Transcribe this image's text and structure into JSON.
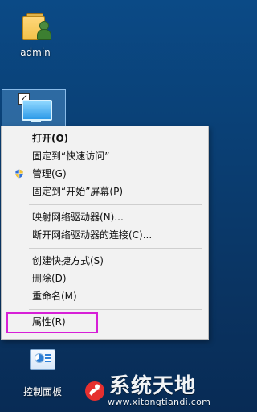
{
  "desktop": {
    "admin_label": "admin",
    "control_panel_label": "控制面板",
    "selected_icon_name": "computer"
  },
  "context_menu": {
    "items": [
      {
        "label": "打开(O)",
        "bold": true
      },
      {
        "label": "固定到“快速访问”"
      },
      {
        "label": "管理(G)",
        "icon": "shield-icon"
      },
      {
        "label": "固定到“开始”屏幕(P)"
      },
      {
        "label": "映射网络驱动器(N)..."
      },
      {
        "label": "断开网络驱动器的连接(C)..."
      },
      {
        "label": "创建快捷方式(S)"
      },
      {
        "label": "删除(D)"
      },
      {
        "label": "重命名(M)"
      },
      {
        "label": "属性(R)"
      }
    ]
  },
  "watermark": {
    "title": "系统天地",
    "url": "www.xitongtiandi.com"
  },
  "colors": {
    "desktop": "#0a3f74",
    "menu": "#f2f2f2",
    "highlight": "#d71fd7"
  }
}
